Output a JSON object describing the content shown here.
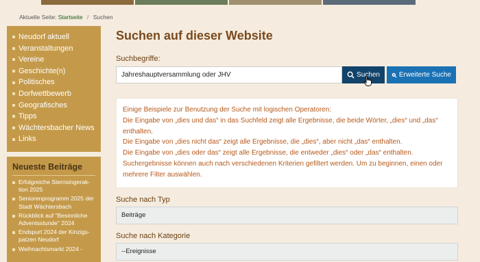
{
  "breadcrumb": {
    "prefix": "Aktuelle Seite:",
    "home": "Startseite",
    "separator": "/",
    "current": "Suchen"
  },
  "sidebar": {
    "nav_items": [
      {
        "label": "Neudorf aktuell"
      },
      {
        "label": "Veranstaltungen"
      },
      {
        "label": "Vereine"
      },
      {
        "label": "Geschichte(n)"
      },
      {
        "label": "Politisches"
      },
      {
        "label": "Dorfwettbewerb"
      },
      {
        "label": "Geografisches"
      },
      {
        "label": "Tipps"
      },
      {
        "label": "Wächtersbacher News"
      },
      {
        "label": "Links"
      }
    ],
    "news_title": "Neueste Beiträge",
    "news_items": [
      {
        "label": "Erfolgreiche Sternsingerak-tion 2025"
      },
      {
        "label": "Seniorenprogramm 2025 der Stadt Wächtersbach"
      },
      {
        "label": "Rückblick auf \"Besinnliche Adventsstunde\" 2024"
      },
      {
        "label": "Endspurt 2024 der Kinzigs-patzen Neudorf"
      },
      {
        "label": "Weihnachtsmarkt 2024 -"
      }
    ]
  },
  "main": {
    "title": "Suchen auf dieser Website",
    "search_label": "Suchbegriffe:",
    "search_value": "Jahreshauptversammlung oder JHV",
    "search_button": "Suchen",
    "advanced_button": "Erweiterte Suche",
    "info_lines": [
      "Einige Beispiele zur Benutzung der Suche mit logischen Operatoren:",
      "Die Eingabe von „dies und das“ in das Suchfeld zeigt alle Ergebnisse, die beide Wörter, „dies“ und „das“ enthalten.",
      "Die Eingabe von „dies nicht das“ zeigt alle Ergebnisse, die „dies“, aber nicht „das“ enthalten.",
      "Die Eingabe von „dies oder das“ zeigt alle Ergebnisse, die entweder „dies“ oder „das“ enthalten.",
      "Suchergebnisse können auch nach verschiedenen Kriterien gefiltert werden. Um zu beginnen, einen oder mehrere Filter auswählen."
    ],
    "type_label": "Suche nach Typ",
    "type_value": "Beiträge",
    "category_label": "Suche nach Kategorie",
    "category_value": "--Ereignisse"
  },
  "colors": {
    "sidebar_bg": "#c49a4a",
    "title": "#7a4a1c",
    "info_text": "#b5581a",
    "search_button": "#12436b",
    "advanced_button": "#1a72b5",
    "page_bg": "#f5ecdf"
  }
}
